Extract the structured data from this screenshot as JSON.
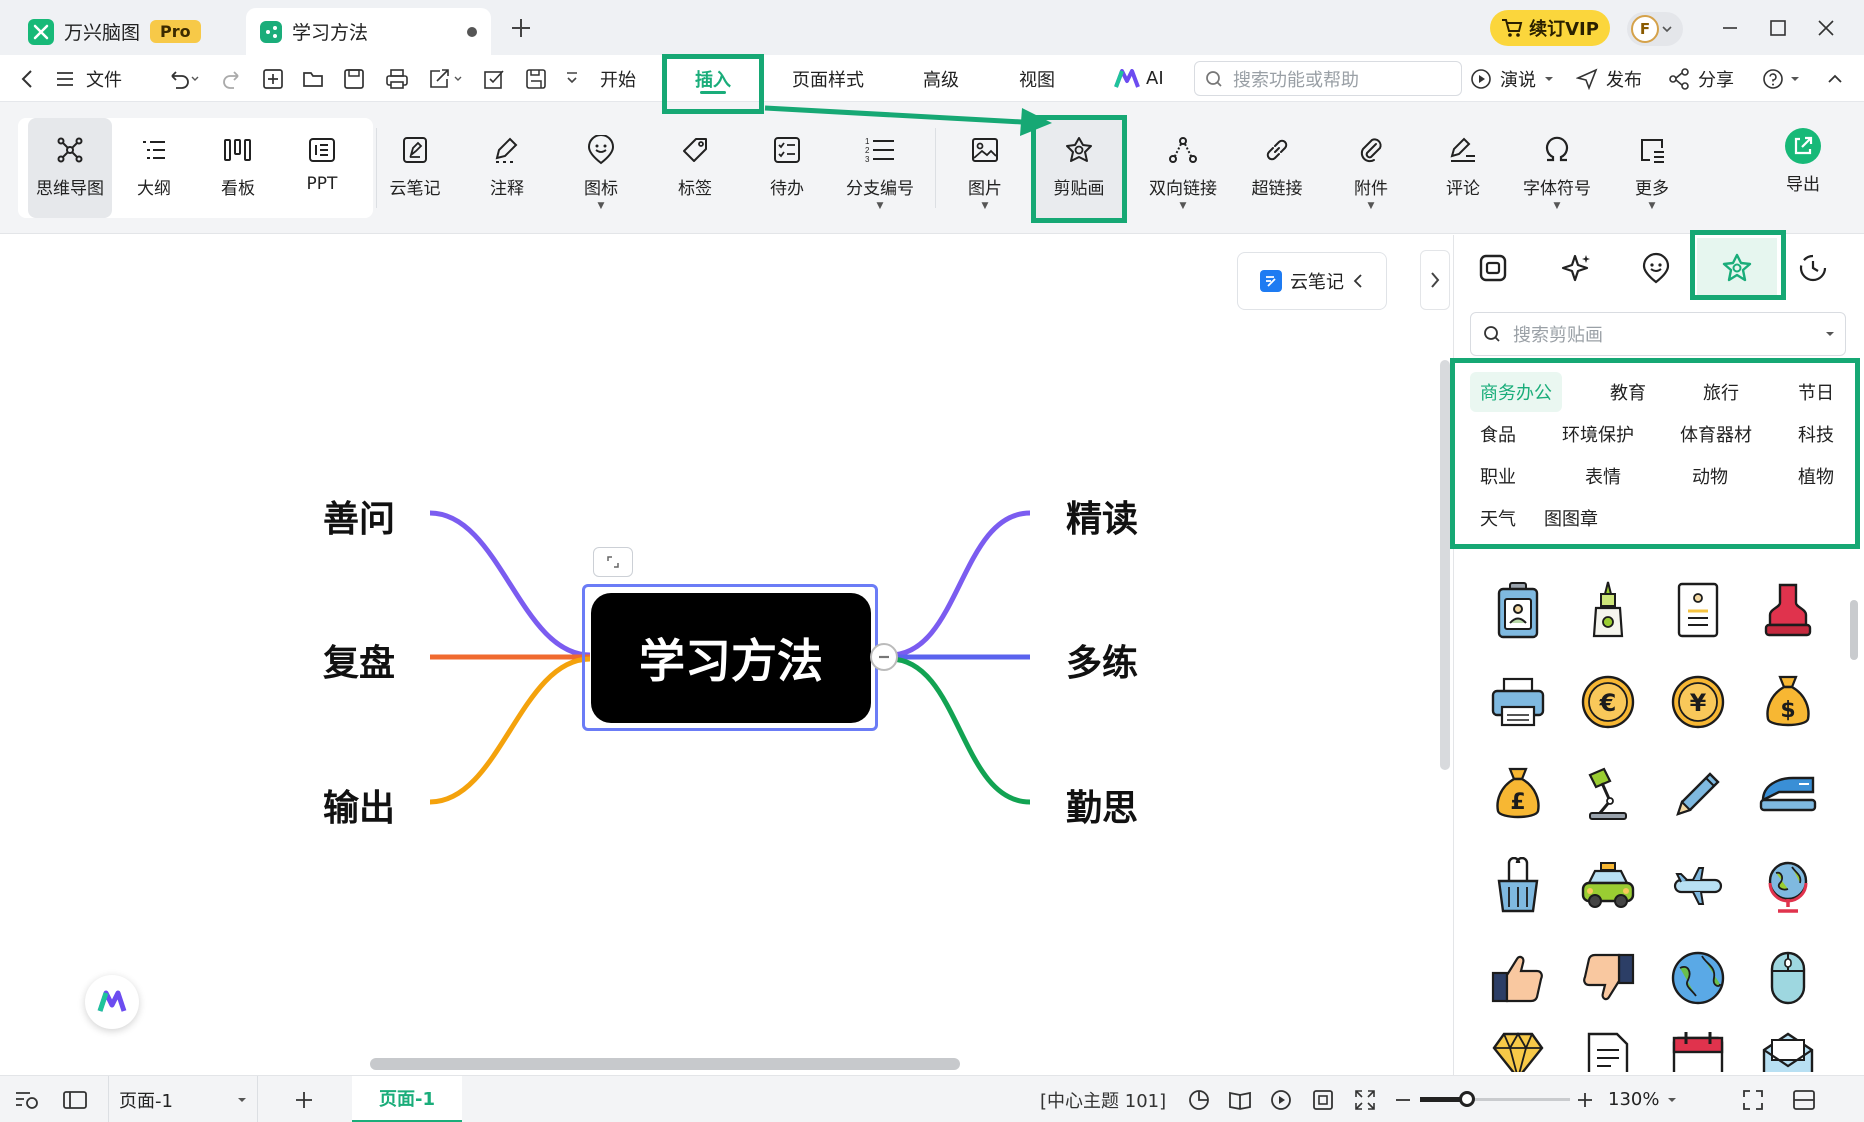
{
  "titlebar": {
    "app_name": "万兴脑图",
    "pro_badge": "Pro",
    "doc_tab": "学习方法",
    "vip_label": "续订VIP",
    "avatar_letter": "F"
  },
  "menubar": {
    "file": "文件",
    "tabs": [
      "开始",
      "插入",
      "页面样式",
      "高级",
      "视图",
      "AI"
    ],
    "active_tab": "插入",
    "search_placeholder": "搜索功能或帮助",
    "present": "演说",
    "publish": "发布",
    "share": "分享"
  },
  "ribbon": {
    "views": [
      "思维导图",
      "大纲",
      "看板",
      "PPT"
    ],
    "tools": [
      "云笔记",
      "注释",
      "图标",
      "标签",
      "待办",
      "分支编号",
      "图片",
      "剪贴画",
      "双向链接",
      "超链接",
      "附件",
      "评论",
      "字体符号",
      "更多"
    ],
    "export": "导出"
  },
  "mindmap": {
    "central": "学习方法",
    "left_branches": [
      "善问",
      "复盘",
      "输出"
    ],
    "right_branches": [
      "精读",
      "多练",
      "勤思"
    ],
    "colors": {
      "purple": "#7b5cf0",
      "orange": "#f06a2f",
      "amber": "#f4a20c",
      "blue": "#5a63ee",
      "green": "#12a352",
      "selection": "#6b7cf6"
    }
  },
  "canvas": {
    "cloud_note": "云笔记"
  },
  "panel": {
    "search_placeholder": "搜索剪贴画",
    "categories": [
      [
        "商务办公",
        "教育",
        "旅行",
        "节日"
      ],
      [
        "食品",
        "环境保护",
        "体育器材",
        "科技"
      ],
      [
        "职业",
        "表情",
        "动物",
        "植物"
      ],
      [
        "天气",
        "图图章"
      ]
    ],
    "active_category": "商务办公",
    "clipart_icons": [
      "id-badge-icon",
      "glue-icon",
      "document-icon",
      "stamp-icon",
      "printer-icon",
      "euro-coin-icon",
      "yen-coin-icon",
      "dollar-bag-icon",
      "pound-bag-icon",
      "desk-lamp-icon",
      "pencil-icon",
      "stapler-icon",
      "binder-clip-icon",
      "taxi-icon",
      "airplane-icon",
      "globe-stand-icon",
      "thumbs-up-icon",
      "thumbs-down-icon",
      "earth-icon",
      "mouse-icon",
      "diamond-icon",
      "paper-icon",
      "calendar-icon",
      "envelope-icon"
    ]
  },
  "statusbar": {
    "page_select": "页面-1",
    "page_tab": "页面-1",
    "topic_info": "[中心主题 101]",
    "zoom": "130%"
  },
  "highlight_color": "#16a874"
}
